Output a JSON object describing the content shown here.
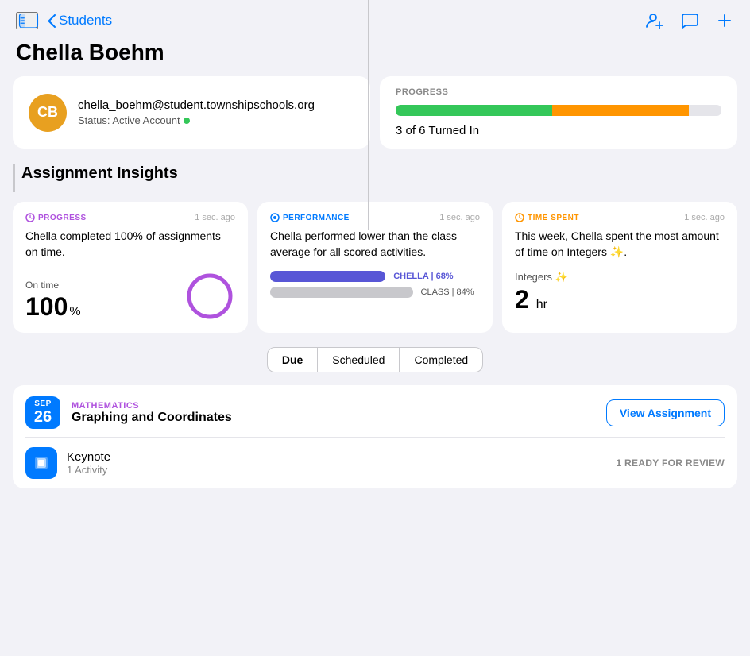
{
  "nav": {
    "back_label": "Students",
    "page_title": "Chella Boehm"
  },
  "student": {
    "initials": "CB",
    "email": "chella_boehm@student.townshipschools.org",
    "status_label": "Status: Active Account",
    "avatar_bg": "#e8a020"
  },
  "progress_card": {
    "label": "PROGRESS",
    "bar_green_pct": 48,
    "bar_orange_pct": 42,
    "summary": "3 of 6 Turned In"
  },
  "insights_section_title": "Assignment Insights",
  "insights": [
    {
      "badge": "PROGRESS",
      "badge_type": "progress",
      "badge_icon": "↻",
      "time_ago": "1 sec. ago",
      "description": "Chella completed 100% of assignments on time.",
      "metric_label": "On time",
      "metric_value": "100",
      "metric_unit": "%"
    },
    {
      "badge": "PERFORMANCE",
      "badge_type": "performance",
      "badge_icon": "◉",
      "time_ago": "1 sec. ago",
      "description": "Chella performed lower than the class average for all scored activities.",
      "chella_label": "CHELLA | 68%",
      "class_label": "CLASS | 84%"
    },
    {
      "badge": "TIME SPENT",
      "badge_type": "time",
      "badge_icon": "⏱",
      "time_ago": "1 sec. ago",
      "description": "This week, Chella spent the most amount of time on Integers ✨.",
      "topic": "Integers ✨",
      "value": "2",
      "unit": "hr"
    }
  ],
  "filter_tabs": [
    {
      "label": "Due",
      "active": true
    },
    {
      "label": "Scheduled",
      "active": false
    },
    {
      "label": "Completed",
      "active": false
    }
  ],
  "assignment": {
    "date_month": "SEP",
    "date_day": "26",
    "subject": "MATHEMATICS",
    "title": "Graphing and Coordinates",
    "view_btn": "View Assignment",
    "activity_name": "Keynote",
    "activity_count": "1 Activity",
    "activity_badge": "1 READY FOR REVIEW"
  }
}
